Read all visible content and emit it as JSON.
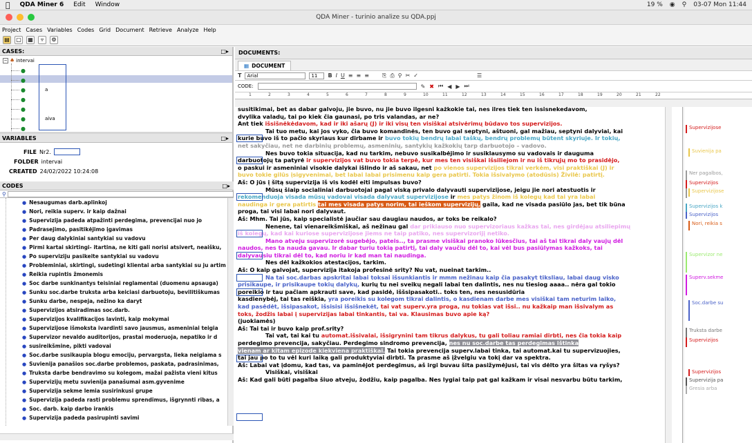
{
  "macmenu": {
    "app": "QDA Miner 6",
    "items": [
      "Edit",
      "Window"
    ],
    "status": [
      "19 %",
      "03-07 Mon 11:44"
    ]
  },
  "window": {
    "title": "QDA Miner - turinio analize su QDA.ppj"
  },
  "app_menu": [
    "Project",
    "Cases",
    "Variables",
    "Codes",
    "Grid",
    "Document",
    "Retrieve",
    "Analyze",
    "Help"
  ],
  "cases": {
    "header": "CASES:",
    "root": "intervai",
    "items": [
      "a",
      "aiva"
    ]
  },
  "variables": {
    "header": "VARIABLES",
    "file_label": "FILE",
    "file_value": "Nr2.",
    "folder_label": "FOLDER",
    "folder_value": "intervai",
    "created_label": "CREATED",
    "created_value": "24/02/2022 10:24:08"
  },
  "codes": {
    "header": "CODES",
    "items": [
      "Nesaugumas darb.aplinkoj",
      "Nori, reikia superv. ir kaip dažnai",
      "Supervizija padeda atpažinti perdegima, prevencijai nuo jo",
      "Padrasejimo, pasitikėjimo įgavimas",
      "Per daug dalykiniai santykiai su vadovu",
      "Pirmi kartai skirtingi- itartina, ne kiti gali norisi atsivert, neaišku,",
      "Po superviziju pasikeite santykiai su vadovu",
      "Probleminiai, skirtingi, sudetingi klientai arba santykiai su ju artim",
      "Reikia rupintis žmonemis",
      "Soc darbe sunkinantys teisiniai reglamentai (duomenu apsauga)",
      "Sunku soc.darbe truksta arba keiciasi darbuotoju, bevilitiškumas",
      "Sunku darbe, nespeja, nežino ka daryt",
      "Supervizijos atsiradimas soc.darb.",
      "Supervizijos kvalifikacijos lavinti, kaip mokymai",
      "Supervizijose išmoksta ivardinti savo jausmus, asmeniniai teigia",
      "Supervizor nevaldo auditorijos, prastai moderuoja, nepatiko ir d",
      "susireikšmine, pikti vadovai",
      "Soc.darbe susikaupia blogu emociju, pervargsta, lieka neigiama s",
      "Suvienija panašios soc.darbe problemos, paskata, padrasinimas,",
      "Truksta darbe bendravimo su kolegom, mažai pažista vieni kitus",
      "Supervizijų metu suvienija panašumai asm.gyvenime",
      "Supervizija sekme lemia susirinkusi grupe",
      "Supervizija padeda rasti problemu sprendimus, išgrynnti ribas, a",
      "Soc. darb. kaip darbo irankis",
      "Supervizija padeda pasirupinti savimi"
    ]
  },
  "documents": {
    "header": "DOCUMENTS:",
    "tab": "DOCUMENT",
    "font": "Arial",
    "size": "11",
    "code_label": "CODE:"
  },
  "doc_lines": {
    "l1": "susitikimai, bet as dabar galvoju, jie buvo, nu jie buvo ilgesni kažkokie tai, nes ilres tiek ten issisnekedavom,",
    "l2": "dvylika valadų, tai po kiek čia gaunasi, po tris valandas, ar ne?",
    "l3a": "Ant tiek ",
    "l3b": "išsišnėkėdavom, kad ir iki ašarų (J) ir iki visų ten visiškai atsivėrimų būdavo tos supervizijos.",
    "l4": "Tai tuo metu, kai jos vyko, čia buvo komandinės, ten buvo gal septyni, aštuoni, gal mažiau, septyni dalyviai, kai",
    "l5a": "kurie buvo iš to pačio skyriaus kur dirbame ir ",
    "l5b": "buvo tokių bendrų labai taškų, bendrų problemų būtent skyriuje. Ir tokių,",
    "l6": "net sakyčiau, net ne darbinių problemų, asmeninių, santykių kažkokių tarp darbuotojo – vadovo.",
    "l7": "Nes buvo tokia situacija, kad nu tarkim, nebuvo susikalbėjimo ir susiklausymo su vadovais ir dauguma",
    "l8a": "darbuotojų ta patyrė ",
    "l8b": "ir supervizijos vat buvo tokia terpė, kur mes ten visiškai išsiliejom ir nu iš tikrųjų mo to prasidėjo,",
    "l9a": "o paskui ir asmeniniai visokie dalykai išlindo ir aš sakau, net ",
    "l9b": "po vienos supervizijos tikrai verkėm, visi praktiškai (J) ir",
    "l10": "buvo tokie gilūs įsigyvenimai, bet labai labai prisimenu kaip gera patirti. Tokia išsivalymo (atodūsis) Živilė: patirtį.",
    "l11": "Aš: O jūs į šitą supervizija iš vis kodėl eiti impulsas buvo?",
    "l12": "Mūsų šiaip socialiniai darbuotojai pagal viską privalo dalyvauti supervizijose, jeigu jie nori atestuotis ir",
    "l13a": "rekomenduoja visada mūsų vadovai visada dalyvaut supervizijose ",
    "l13b": "ir ",
    "l13c": "mes patys žinom iš kolegų kad tai yra labai",
    "l14a": "naudinga ir gera patirtis ",
    "l14b": "tai mes visada patys norim, tai ieškom supervizijų,",
    "l14c": " gaila, kad ne visada pasiūlo jas, bet tik būna",
    "l15": "proga, tai visi labai nori dalyvaut.",
    "l16": "Aš: Mhm. Tai jūs, kaip specialistė jaučiar sau daugiau naudos, ar toks be reikalo?",
    "l17a": "Nenene, tai vienareikšmiškai, aš nežinau gal ",
    "l17b": "dar prikiauso nuo supervizoriaus kažkas tai, nes girdėjau atsiliepimų",
    "l18": "iš kolegų, kad kai kuriose supervizijose jiems ne taip patiko, nes supervizorijį netiko.",
    "l19": "Mano atveju supervizorė sugebėjo, pateis.., ta prasme visiškai pranoko lūkesčius, tai aš tai tikrai daly vaujų dėl",
    "l20": "naudos, nes ta nauda gavau. Ir dabar turiu tokią patirtį, tai daly vaučiu dėl to, kai vėl bus pasiūlymas kažkoks, tai",
    "l21": "dalyvausiu tikrai dėl to, kad noriu ir kad man tai naudinga.",
    "l22": "Nes dėl kažkokios atestacijos, tarkim.",
    "l23": "Aš: O kaip galvojat, supervizija itakoja profesinė srity? Nu vat, nueinat tarkim..",
    "l24": "Na tai soc.darbas apskritai labai toksai išsunkiantis ir mmm nežinau kaip čia pasakyt tiksliau, labai daug visko",
    "l25a": "prisikaupe, ir prisikaupe tokių dalykų, ",
    "l25b": "kurių tu nei sveikų negali labai ten dalintis, nes nu tiesiog aaaa.. nėra gal tokio",
    "l26": "poreikio ir tau pačiam apkrauti save, kad pasidė, iššsipasakoti.. toks ten, nes nesusidūria",
    "l27a": "kasdienybėj, tai tas reiškia, ",
    "l27b": "yra poreikis su kolegom tikrai dalintis, o kasdienam darbe mes visiškai tam neturim laiko,",
    "l28a": "kad pasėdėt, išsipasakot, išsisisi išsišnekėt, ",
    "l28b": "tai vat superv.yra proga, nu tokias vat išsi.. nu kažkaip man išsivalym as",
    "l29": "toks, žodžis labai į supervizijas labai tinkantis, tai va. Klausimas buvo apie ką?",
    "l30": "(juokiamės)",
    "l31": "Aš: Tai tai ir buvo kaip prof.srity?",
    "l32a": "Tai vat, tai kai tu ",
    "l32b": "automat.išsivalai, išsigrynini tam tikrus dalykus, tu gali toliau ramiai dirbti, nes čia tokia kaip",
    "l33a": "perdegimo prevencija, sakyčiau. Perdegimo sindromo prevencija, ",
    "l33b": "nes nu soc.darbe tas perdegimas ištinka",
    "l34a": "vienam ar kitam epizode kiekviena praktiškai.",
    "l34b": " Tai tokia prevencija superv.labai tinka, tai automat.kai tu supervizuojies,",
    "l35": "tai jau po to tu vėl kuri laiką gali produktyviai dirbti. Ta prasme aš įžvelgiu va tokį dar va spektra.",
    "l36": "Aš: Labai vat įdomu, kad tas, va paminėjot perdegimus, aš irgi buvau šita pasižymėjusi, tai vis dėlto yra šitas va ryšys?",
    "l37": "Visiškai, visiškai",
    "l38": "Aš: Kad gali būti pagalba šiuo atveju, žodžiu, kaip pagalba. Nes lygiai taip pat gal kažkam ir visai nesvarbu būtu tarkim,"
  },
  "margin_codes": [
    "Supervizijose",
    "Suvienija pa",
    "Ner pagalbos,",
    "Supervizijos",
    "Supervizijose",
    "Supervizijos k",
    "Supervizijos",
    "Nori, reikia s",
    "Supervizor ne",
    "Superv.sekme",
    "Soc.darbe su",
    "Truksta darbe",
    "Supervizijos",
    "Supervizijos",
    "Supervizija pa",
    "Gresia arba"
  ]
}
